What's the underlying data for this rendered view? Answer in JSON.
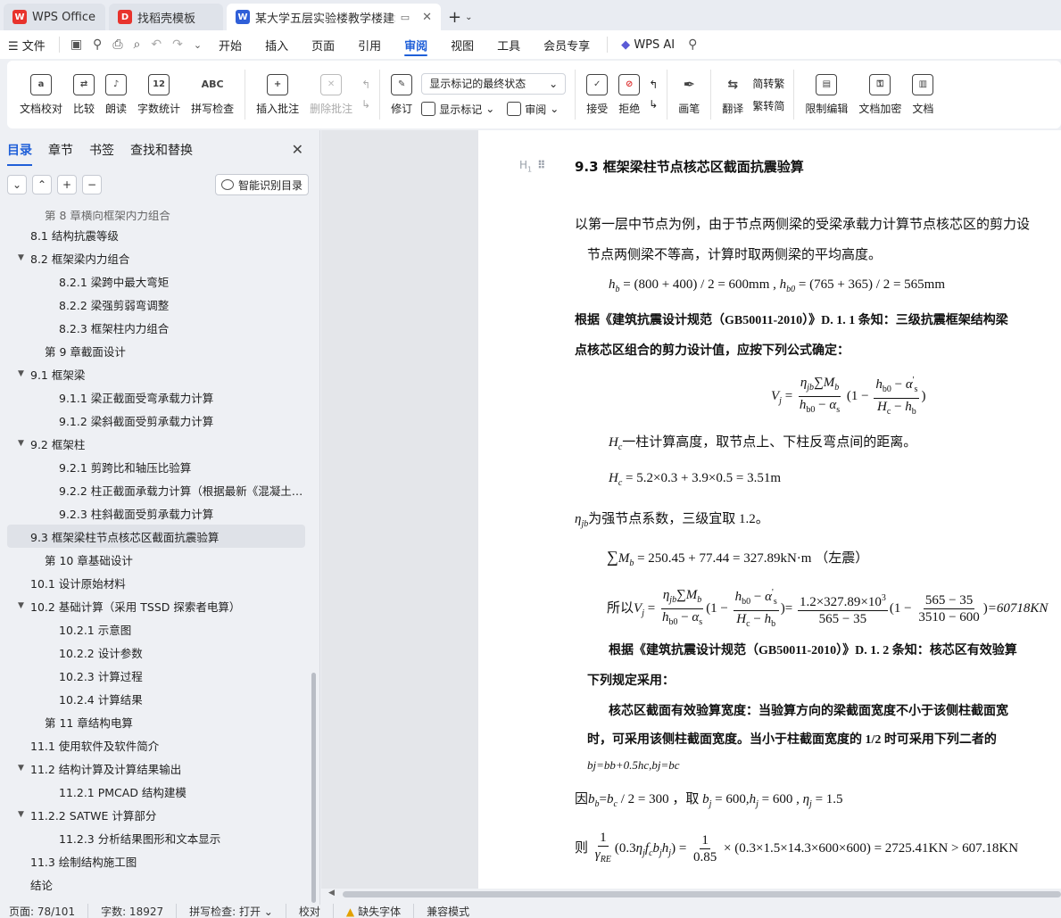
{
  "titlebar": {
    "tabs": [
      {
        "label": "WPS Office",
        "logo": "W"
      },
      {
        "label": "找稻壳模板",
        "logo": "D"
      },
      {
        "label": "某大学五层实验楼教学楼建筑",
        "logo": "W"
      }
    ],
    "new_tab": "+"
  },
  "menu": {
    "file": "文件",
    "tabs": [
      "开始",
      "插入",
      "页面",
      "引用",
      "审阅",
      "视图",
      "工具",
      "会员专享"
    ],
    "active_tab": "审阅",
    "wps_ai": "WPS AI"
  },
  "ribbon": {
    "proofread": "文档校对",
    "compare": "比较",
    "read_aloud": "朗读",
    "word_count": "字数统计",
    "spell_check": "拼写检查",
    "insert_comment": "插入批注",
    "delete_comment": "删除批注",
    "revise": "修订",
    "markup_state": "显示标记的最终状态",
    "show_markup": "显示标记",
    "review_pane": "审阅",
    "accept": "接受",
    "reject": "拒绝",
    "ink": "画笔",
    "translate": "翻译",
    "to_traditional": "简转繁",
    "to_simplified": "繁转简",
    "restrict_edit": "限制编辑",
    "encrypt": "文档加密",
    "doc_more": "文档"
  },
  "nav": {
    "tabs": [
      "目录",
      "章节",
      "书签",
      "查找和替换"
    ],
    "active_tab": "目录",
    "smart_button": "智能识别目录",
    "toc": [
      {
        "label": "第 8 章横向框架内力组合",
        "level": 1,
        "clip": true
      },
      {
        "label": "8.1  结构抗震等级",
        "level": 2
      },
      {
        "label": "8.2  框架梁内力组合",
        "level": 2,
        "arrow": true
      },
      {
        "label": "8.2.1  梁跨中最大弯矩",
        "level": 3
      },
      {
        "label": "8.2.2  梁强剪弱弯调整",
        "level": 3
      },
      {
        "label": "8.2.3  框架柱内力组合",
        "level": 3
      },
      {
        "label": "第 9 章截面设计",
        "level": 1
      },
      {
        "label": "9.1  框架梁",
        "level": 2,
        "arrow": true
      },
      {
        "label": "9.1.1  梁正截面受弯承载力计算",
        "level": 3
      },
      {
        "label": "9.1.2  梁斜截面受剪承载力计算",
        "level": 3
      },
      {
        "label": "9.2  框架柱",
        "level": 2,
        "arrow": true
      },
      {
        "label": "9.2.1  剪跨比和轴压比验算",
        "level": 3
      },
      {
        "label": "9.2.2  柱正截面承载力计算（根据最新《混凝土…",
        "level": 3
      },
      {
        "label": "9.2.3  柱斜截面受剪承载力计算",
        "level": 3
      },
      {
        "label": "9.3  框架梁柱节点核芯区截面抗震验算",
        "level": 2,
        "selected": true
      },
      {
        "label": "第 10 章基础设计",
        "level": 1
      },
      {
        "label": "10.1  设计原始材料",
        "level": 2
      },
      {
        "label": "10.2  基础计算（采用 TSSD 探索者电算）",
        "level": 2,
        "arrow": true
      },
      {
        "label": "10.2.1  示意图",
        "level": 3
      },
      {
        "label": "10.2.2  设计参数",
        "level": 3
      },
      {
        "label": "10.2.3  计算过程",
        "level": 3
      },
      {
        "label": "10.2.4  计算结果",
        "level": 3
      },
      {
        "label": "第 11 章结构电算",
        "level": 1
      },
      {
        "label": "11.1  使用软件及软件简介",
        "level": 2
      },
      {
        "label": "11.2  结构计算及计算结果输出",
        "level": 2,
        "arrow": true
      },
      {
        "label": "11.2.1 PMCAD 结构建模",
        "level": 3
      },
      {
        "label": "11.2.2 SATWE 计算部分",
        "level": 2,
        "arrow": true
      },
      {
        "label": "11.2.3  分析结果图形和文本显示",
        "level": 3
      },
      {
        "label": "11.3  绘制结构施工图",
        "level": 2
      },
      {
        "label": "结论",
        "level": 2
      }
    ]
  },
  "doc": {
    "hmark": "H",
    "heading": "9.3  框架梁柱节点核芯区截面抗震验算",
    "p1a": "以第一层中节点为例，由于节点两侧梁的受梁承载力计算节点核芯区的剪力设",
    "p1b": "节点两侧梁不等高，计算时取两侧梁的平均高度。",
    "eq_hb": "h",
    "eq_hb_rest": " = (800 + 400) / 2 = 600mm , ",
    "eq_hb0_rest": " = (765 + 365) / 2 = 565mm",
    "p2a": "根据《建筑抗震设计规范（GB50011-2010）》D. 1. 1 条知：三级抗震框架结构梁",
    "p2b": "点核芯区组合的剪力设计值，应按下列公式确定：",
    "p3": "一柱计算高度，取节点上、下柱反弯点间的距离。",
    "eq_hc": " = 5.2×0.3 + 3.9×0.5 = 3.51m",
    "p4": "为强节点系数，三级宜取 1.2。",
    "eq_mb": " = 250.45 + 77.44 = 327.89kN·m （左震）",
    "eq_vj_prefix": "所以",
    "eq_vj_value": "=60718KN",
    "p5a": "根据《建筑抗震设计规范（GB50011-2010）》D. 1. 2 条知：核芯区有效验算",
    "p5b": "下列规定采用：",
    "p6a": "核芯区截面有效验算宽度：当验算方向的梁截面宽度不小于该侧柱截面宽",
    "p6b": "时，可采用该侧柱截面宽度。当小于柱截面宽度的 1/2 时可采用下列二者的",
    "p6c": "bj=bb+0.5hc,bj=bc",
    "eq_because": "因",
    "eq_because_rest": " / 2 = 300 ，取 ",
    "eq_because_tail": " = 600 ,  ",
    "eq_because_end": " = 1.5",
    "eq_then": "则",
    "eq_then_rest": " × (0.3×1.5×14.3×600×600) = 2725.41KN > 607.18KN"
  },
  "status": {
    "page": "页面: 78/101",
    "words": "字数: 18927",
    "spell": "拼写检查: 打开",
    "proof": "校对",
    "font_missing": "缺失字体",
    "compat": "兼容模式"
  }
}
